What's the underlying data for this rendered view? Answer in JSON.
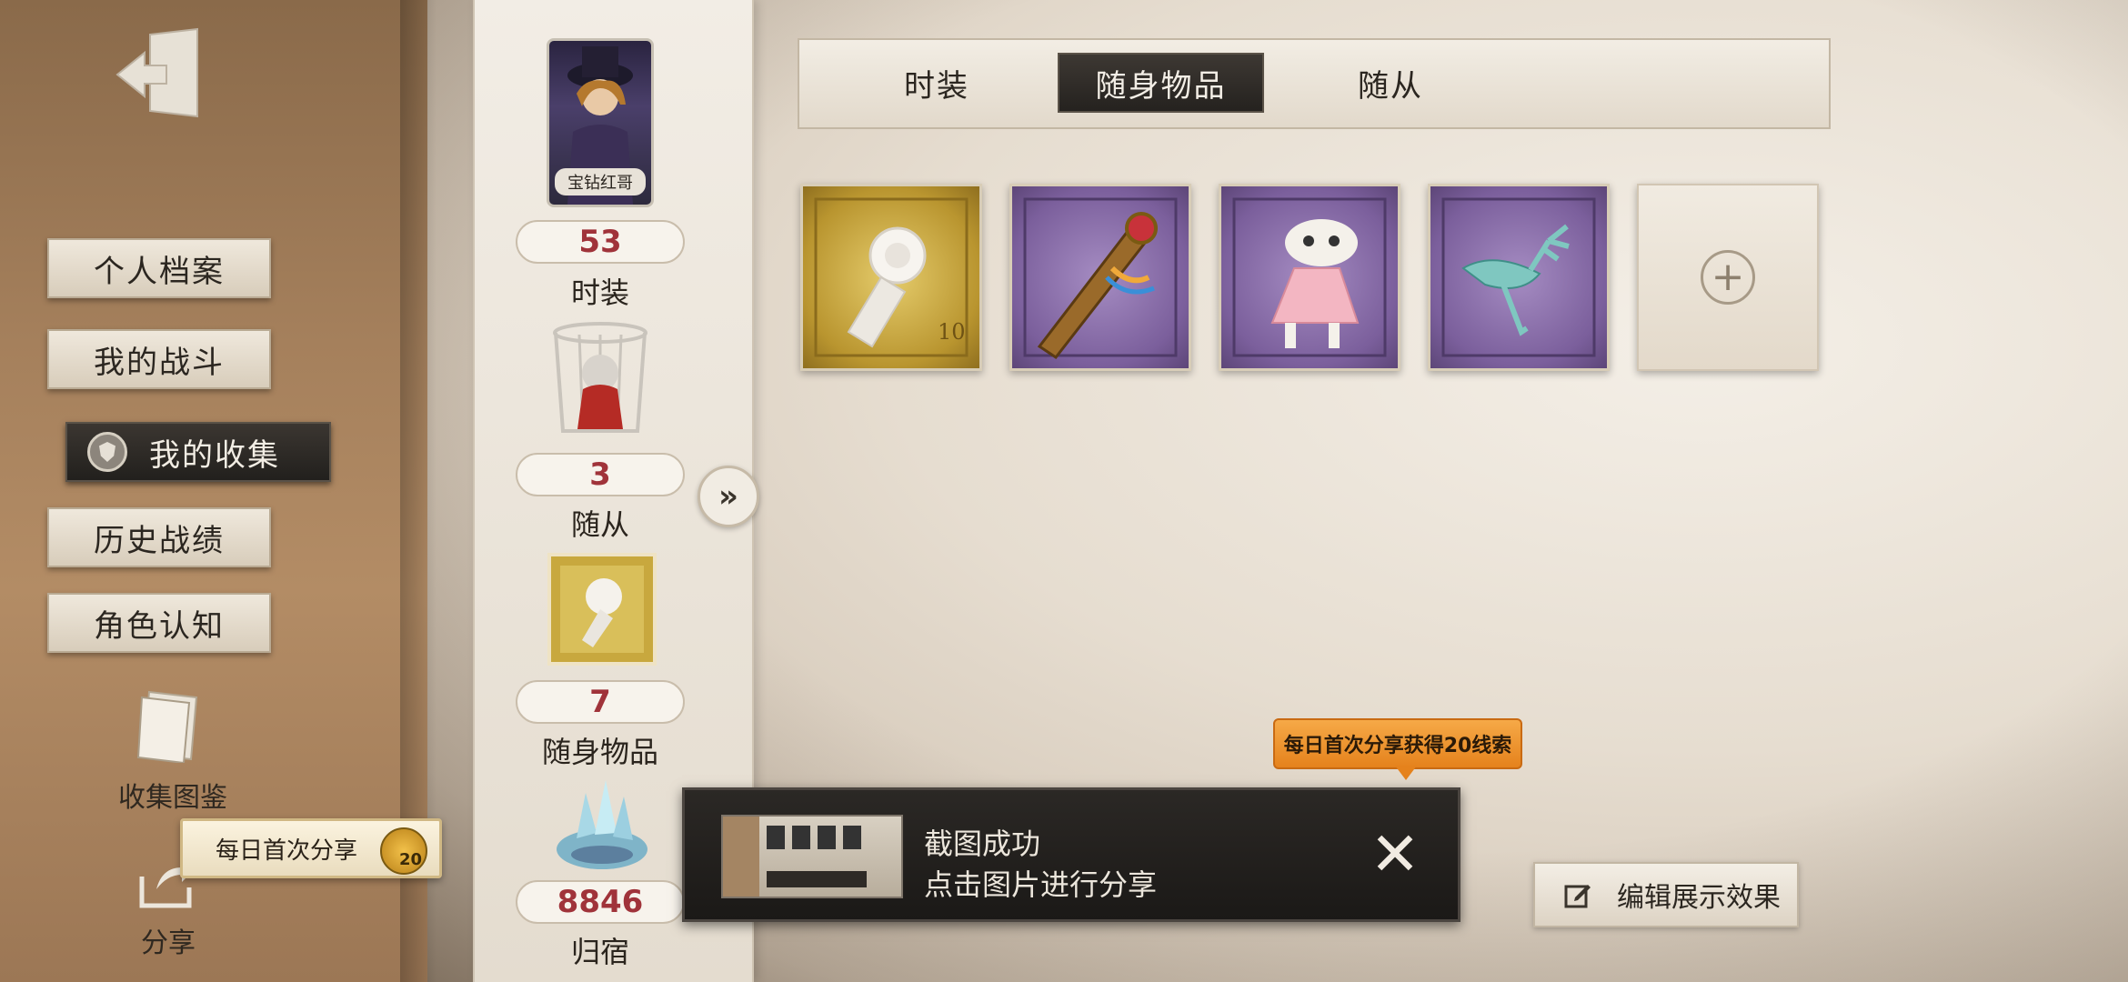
{
  "sidebar": {
    "items": [
      {
        "label": "个人档案"
      },
      {
        "label": "我的战斗"
      },
      {
        "label": "我的收集"
      },
      {
        "label": "历史战绩"
      },
      {
        "label": "角色认知"
      }
    ],
    "active_index": 2,
    "book_label": "收集图鉴",
    "share_label": "分享",
    "share_tip": "每日首次分享",
    "share_badge": "20"
  },
  "profile": {
    "card_name": "宝钻红哥",
    "stats": [
      {
        "value": "53",
        "label": "时装"
      },
      {
        "value": "3",
        "label": "随从"
      },
      {
        "value": "7",
        "label": "随身物品"
      },
      {
        "value": "8846",
        "label": "归宿"
      }
    ]
  },
  "tabs": [
    {
      "label": "时装"
    },
    {
      "label": "随身物品"
    },
    {
      "label": "随从"
    }
  ],
  "active_tab": 1,
  "items": [
    {
      "icon": "white-rose-bouquet-icon",
      "frame": "gold"
    },
    {
      "icon": "jeweled-scepter-icon",
      "frame": "purple"
    },
    {
      "icon": "pink-dress-doll-icon",
      "frame": "purple"
    },
    {
      "icon": "teal-deer-icon",
      "frame": "purple"
    },
    {
      "icon": "add-slot-icon",
      "frame": "empty"
    }
  ],
  "toast": {
    "line1": "截图成功",
    "line2": "点击图片进行分享",
    "close": "✕"
  },
  "reward_tip": "每日首次分享获得20线索",
  "edit_button": "编辑展示效果",
  "colors": {
    "count_red": "#a0333a",
    "reward_orange": "#e5821c",
    "dark_tab": "#25221f"
  }
}
